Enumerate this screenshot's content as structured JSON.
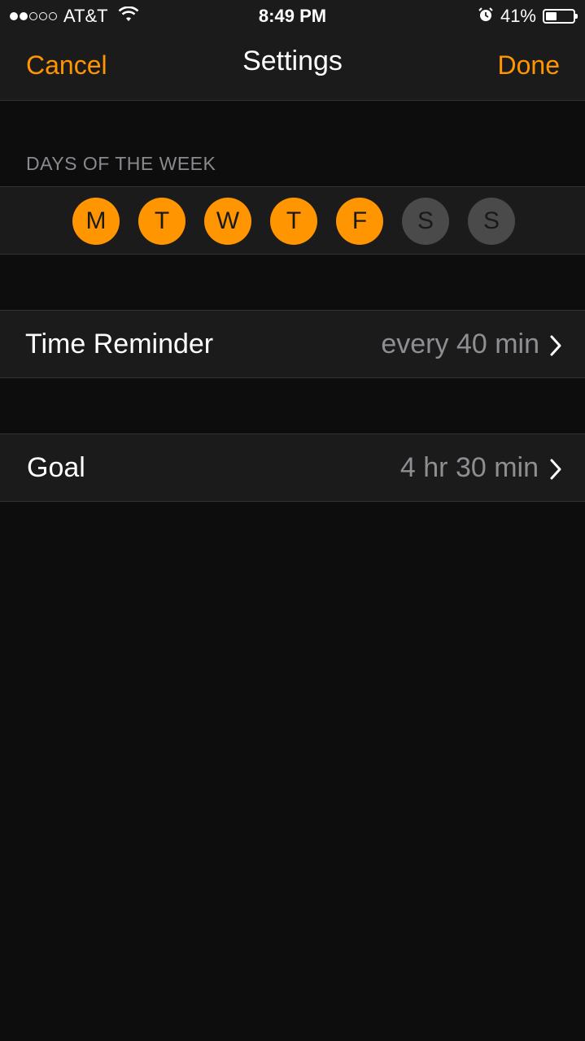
{
  "status_bar": {
    "signal_dots_filled": 2,
    "signal_dots_total": 5,
    "carrier": "AT&T",
    "time": "8:49 PM",
    "battery_percent": "41%",
    "battery_level": 0.41
  },
  "nav": {
    "cancel_label": "Cancel",
    "title": "Settings",
    "done_label": "Done"
  },
  "days_section": {
    "header": "DAYS OF THE WEEK",
    "days": [
      {
        "letter": "M",
        "selected": true
      },
      {
        "letter": "T",
        "selected": true
      },
      {
        "letter": "W",
        "selected": true
      },
      {
        "letter": "T",
        "selected": true
      },
      {
        "letter": "F",
        "selected": true
      },
      {
        "letter": "S",
        "selected": false
      },
      {
        "letter": "S",
        "selected": false
      }
    ]
  },
  "time_reminder": {
    "label": "Time Reminder",
    "value": "every 40 min"
  },
  "goal": {
    "label": "Goal",
    "value": "4 hr 30 min"
  },
  "colors": {
    "accent": "#ff9500",
    "background": "#0d0d0d",
    "cell_background": "#1b1b1b",
    "day_off": "#4a4a4a"
  }
}
